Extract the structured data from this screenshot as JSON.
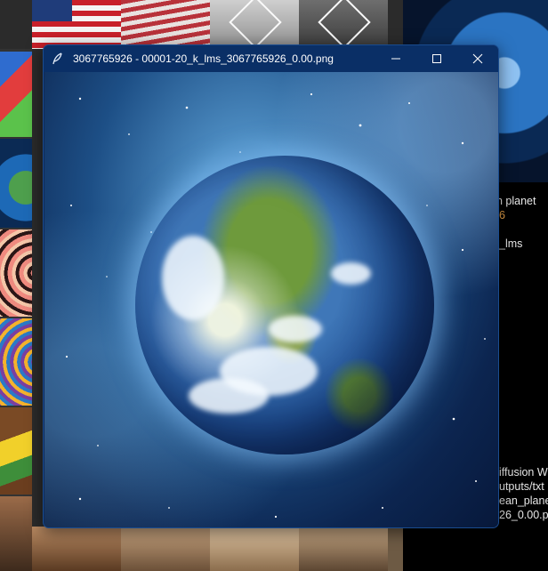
{
  "window": {
    "title": "3067765926 - 00001-20_k_lms_3067765926_0.00.png",
    "minimize_glyph": "minimize-icon",
    "maximize_glyph": "maximize-icon",
    "close_glyph": "close-icon"
  },
  "side_panel": {
    "lines": [
      {
        "text": "n planet"
      },
      {
        "text": "6"
      },
      {
        "text": "_lms"
      },
      {
        "text": "iffusion W"
      },
      {
        "text": "utputs/txt"
      },
      {
        "text": "ean_plane"
      },
      {
        "text": "26_0.00.p"
      }
    ]
  },
  "colors": {
    "titlebar": "#0a2f66",
    "accent_text": "#e8a34a",
    "panel_bg": "#000000"
  }
}
